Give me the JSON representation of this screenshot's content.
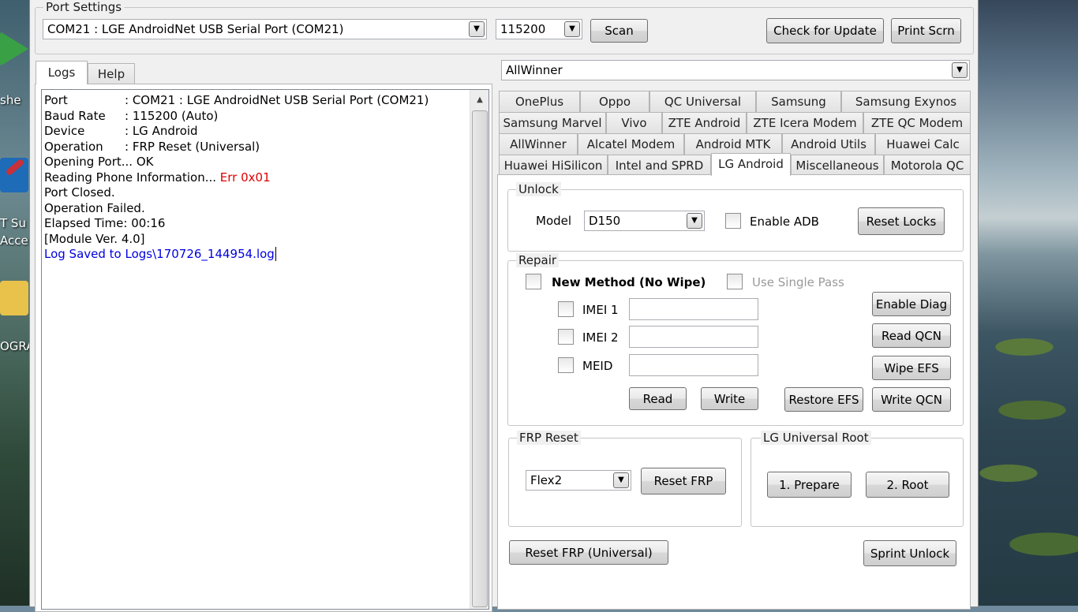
{
  "desktop": {
    "icons": [
      {
        "label": "she",
        "color": "#3aa046"
      },
      {
        "label": "T Su",
        "sublabel": "Acce",
        "color": "#c8313a"
      },
      {
        "label": "OGRA",
        "color": "#e8c24a"
      }
    ]
  },
  "port_settings": {
    "title": "Port Settings",
    "port_value": "COM21 : LGE AndroidNet USB Serial Port (COM21)",
    "baud_value": "115200",
    "scan_label": "Scan",
    "check_update_label": "Check for Update",
    "print_screen_label": "Print Scrn"
  },
  "left_tabs": [
    {
      "label": "Logs",
      "active": true
    },
    {
      "label": "Help",
      "active": false
    }
  ],
  "log": {
    "lines": [
      {
        "key": "Port",
        "value": ": COM21 : LGE AndroidNet USB Serial Port (COM21)"
      },
      {
        "key": "Baud Rate",
        "value": ": 115200 (Auto)"
      },
      {
        "key": "Device",
        "value": ": LG Android"
      },
      {
        "key": "Operation",
        "value": ": FRP Reset (Universal)"
      }
    ],
    "opening_port": "Opening Port... OK",
    "reading_info": "Reading Phone Information... ",
    "reading_error": "Err 0x01",
    "port_closed": "Port Closed.",
    "operation_failed": "Operation Failed.",
    "elapsed": "Elapsed Time: 00:16",
    "module_ver": "[Module Ver. 4.0]",
    "log_saved": "Log Saved to Logs\\170726_144954.log",
    "error_color": "#e00000",
    "link_color": "#0000e0"
  },
  "platform_select": {
    "value": "AllWinner"
  },
  "tab_rows": [
    [
      "OnePlus",
      "Oppo",
      "QC Universal",
      "Samsung",
      "Samsung Exynos"
    ],
    [
      "Samsung Marvel",
      "Vivo",
      "ZTE Android",
      "ZTE Icera Modem",
      "ZTE QC Modem"
    ],
    [
      "AllWinner",
      "Alcatel Modem",
      "Android MTK",
      "Android Utils",
      "Huawei Calc"
    ],
    [
      "Huawei HiSilicon",
      "Intel and SPRD",
      "LG Android",
      "Miscellaneous",
      "Motorola QC"
    ]
  ],
  "active_tab": "LG Android",
  "unlock": {
    "title": "Unlock",
    "model_label": "Model",
    "model_value": "D150",
    "enable_adb_label": "Enable ADB",
    "reset_locks_label": "Reset Locks"
  },
  "repair": {
    "title": "Repair",
    "new_method_label": "New Method (No Wipe)",
    "single_pass_label": "Use Single Pass",
    "imei1_label": "IMEI 1",
    "imei2_label": "IMEI 2",
    "meid_label": "MEID",
    "read_label": "Read",
    "write_label": "Write",
    "enable_diag_label": "Enable Diag",
    "read_qcn_label": "Read QCN",
    "wipe_efs_label": "Wipe EFS",
    "restore_efs_label": "Restore EFS",
    "write_qcn_label": "Write QCN"
  },
  "frp_reset": {
    "title": "FRP Reset",
    "flex_value": "Flex2",
    "reset_frp_label": "Reset FRP"
  },
  "lg_root": {
    "title": "LG Universal Root",
    "prepare_label": "1. Prepare",
    "root_label": "2. Root"
  },
  "bottom": {
    "reset_frp_universal_label": "Reset FRP (Universal)",
    "sprint_unlock_label": "Sprint Unlock"
  }
}
